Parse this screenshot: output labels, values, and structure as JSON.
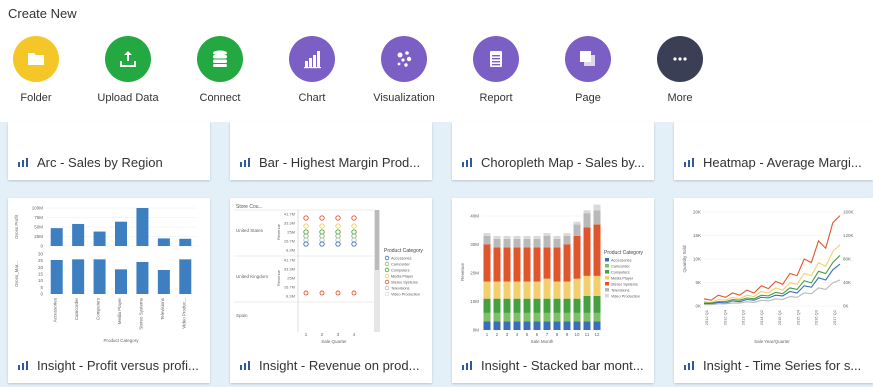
{
  "page": {
    "title": "Create New"
  },
  "create_items": [
    {
      "label": "Folder",
      "color": "#f5c628",
      "icon": "folder-icon"
    },
    {
      "label": "Upload Data",
      "color": "#23a842",
      "icon": "upload-icon"
    },
    {
      "label": "Connect",
      "color": "#23a842",
      "icon": "database-icon"
    },
    {
      "label": "Chart",
      "color": "#7b5fc4",
      "icon": "bar-chart-icon"
    },
    {
      "label": "Visualization",
      "color": "#7b5fc4",
      "icon": "scatter-icon"
    },
    {
      "label": "Report",
      "color": "#7b5fc4",
      "icon": "report-icon"
    },
    {
      "label": "Page",
      "color": "#7b5fc4",
      "icon": "page-stack-icon"
    },
    {
      "label": "More",
      "color": "#3a3f55",
      "icon": "more-icon"
    }
  ],
  "top_cards": [
    {
      "title": "Arc - Sales by Region"
    },
    {
      "title": "Bar - Highest Margin Prod..."
    },
    {
      "title": "Choropleth Map - Sales by..."
    },
    {
      "title": "Heatmap - Average Margi..."
    }
  ],
  "bottom_cards": [
    {
      "title": "Insight - Profit versus profi...",
      "thumb": {
        "y_upper_ticks": [
          "100M",
          "75M",
          "50M",
          "25M",
          "0"
        ],
        "y_upper_label": "Gross Profit",
        "y_lower_ticks": [
          "30",
          "25",
          "20",
          "15",
          "10",
          "5",
          "0"
        ],
        "y_lower_label": "Gross_Mar...",
        "categories": [
          "Accessories",
          "Camcorder",
          "Computers",
          "Media Player",
          "Stereo Systems",
          "Televisions",
          "Video Produc..."
        ],
        "upper_values": [
          47,
          58,
          38,
          64,
          100,
          20,
          19
        ],
        "lower_values": [
          25.5,
          26,
          26,
          18.5,
          24,
          18,
          26
        ],
        "x_label": "Product Category"
      }
    },
    {
      "title": "Insight - Revenue on prod...",
      "thumb": {
        "header": "Store Cou...",
        "rows": [
          "United States",
          "United Kingdom",
          "Spain"
        ],
        "y_ticks": [
          "41.7M",
          "33.3M",
          "25M",
          "16.7M",
          "8.3M"
        ],
        "y_label": "Revenue",
        "x_ticks": [
          "1",
          "2",
          "3",
          "4"
        ],
        "x_label": "Sale Quarter",
        "legend_title": "Product Category",
        "legend": [
          {
            "name": "Accessories",
            "color": "#3a6fb5"
          },
          {
            "name": "Camcorder",
            "color": "#7fbf6a"
          },
          {
            "name": "Computers",
            "color": "#46a040"
          },
          {
            "name": "Media Player",
            "color": "#f2cf6c"
          },
          {
            "name": "Stereo Systems",
            "color": "#e0562c"
          },
          {
            "name": "Televisions",
            "color": "#b9b9b9"
          },
          {
            "name": "Video Production",
            "color": "#d9d9d9"
          }
        ]
      }
    },
    {
      "title": "Insight - Stacked bar mont...",
      "thumb": {
        "y_ticks": [
          "40M",
          "30M",
          "20M",
          "10M",
          "0M"
        ],
        "y_label": "Revenue",
        "x_ticks": [
          "1",
          "2",
          "3",
          "4",
          "5",
          "6",
          "7",
          "8",
          "9",
          "10",
          "11",
          "12"
        ],
        "x_label": "Sale Month",
        "legend_title": "Product Category",
        "legend": [
          {
            "name": "Accessories",
            "color": "#3a6fb5"
          },
          {
            "name": "Camcorder",
            "color": "#7fbf6a"
          },
          {
            "name": "Computers",
            "color": "#46a040"
          },
          {
            "name": "Media Player",
            "color": "#f2cf6c"
          },
          {
            "name": "Stereo Systems",
            "color": "#e0562c"
          },
          {
            "name": "Televisions",
            "color": "#b9b9b9"
          },
          {
            "name": "Video Production",
            "color": "#d9d9d9"
          }
        ],
        "stacks": [
          [
            3,
            3,
            5,
            6,
            13,
            3,
            1
          ],
          [
            3,
            3,
            5,
            6,
            12,
            3,
            1
          ],
          [
            3,
            3,
            5,
            6,
            12,
            3,
            1
          ],
          [
            3,
            3,
            5,
            6,
            12,
            3,
            1
          ],
          [
            3,
            3,
            5,
            6,
            12,
            3,
            1
          ],
          [
            3,
            3,
            5,
            6,
            12,
            3,
            1
          ],
          [
            3,
            3,
            5,
            7,
            11,
            4,
            1
          ],
          [
            3,
            3,
            5,
            6,
            12,
            3,
            1
          ],
          [
            3,
            3,
            5,
            6,
            13,
            3,
            1
          ],
          [
            3,
            3,
            5,
            7,
            15,
            4,
            1
          ],
          [
            3,
            3,
            6,
            7,
            17,
            5,
            1
          ],
          [
            3,
            3,
            6,
            7,
            18,
            5,
            2
          ]
        ]
      }
    },
    {
      "title": "Insight - Time Series for s...",
      "thumb": {
        "y_left_ticks": [
          "20K",
          "15K",
          "10K",
          "5K",
          "0K"
        ],
        "y_left_label": "Quantity Sold",
        "y_right_ticks": [
          "160K",
          "120K",
          "80K",
          "40K",
          "0K"
        ],
        "x_ticks": [
          "2012 Q1",
          "2012 Q4",
          "2013 Q3",
          "2014 Q2",
          "2015 Q1",
          "2015 Q4",
          "2016 Q3",
          "2017 Q2"
        ],
        "x_label": "Sale Year/Quarter",
        "series": [
          {
            "color": "#e0562c",
            "values": [
              1,
              0.8,
              1.5,
              1.2,
              1.8,
              1.5,
              2.2,
              1.8,
              2.8,
              2.4,
              3.4,
              3.0,
              4.5,
              4.2,
              6.5,
              6.0,
              9.0,
              8.0,
              11.5,
              12.5
            ]
          },
          {
            "color": "#f2cf6c",
            "values": [
              0.6,
              0.5,
              0.9,
              0.8,
              1.2,
              1.0,
              1.5,
              1.3,
              2.0,
              1.8,
              2.5,
              2.2,
              3.2,
              3.0,
              4.5,
              4.2,
              6.0,
              5.5,
              7.5,
              8.5
            ]
          },
          {
            "color": "#46a040",
            "values": [
              0.4,
              0.4,
              0.6,
              0.6,
              0.9,
              0.8,
              1.1,
              1.0,
              1.5,
              1.4,
              1.9,
              1.7,
              2.5,
              2.3,
              3.5,
              3.2,
              4.8,
              4.5,
              6.0,
              7.0
            ]
          },
          {
            "color": "#3a6fb5",
            "values": [
              0.3,
              0.3,
              0.5,
              0.4,
              0.7,
              0.6,
              0.9,
              0.8,
              1.2,
              1.1,
              1.5,
              1.4,
              2.0,
              1.8,
              2.8,
              2.6,
              3.9,
              3.6,
              5.0,
              5.8
            ]
          },
          {
            "color": "#b9b9b9",
            "values": [
              0.2,
              0.2,
              0.3,
              0.3,
              0.4,
              0.4,
              0.6,
              0.5,
              0.8,
              0.7,
              1.0,
              0.9,
              1.3,
              1.2,
              1.8,
              1.7,
              2.5,
              2.3,
              3.2,
              3.6
            ]
          }
        ]
      }
    }
  ]
}
